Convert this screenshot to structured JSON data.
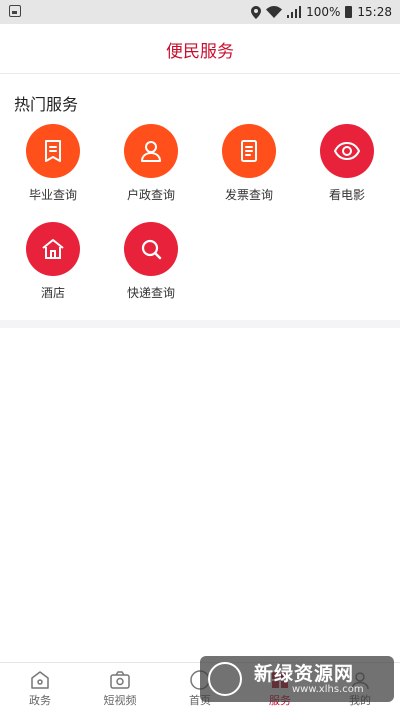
{
  "status_bar": {
    "battery": "100%",
    "time": "15:28"
  },
  "header": {
    "title": "便民服务"
  },
  "section": {
    "title": "热门服务"
  },
  "services": [
    {
      "label": "毕业查询",
      "icon": "bookmark-doc-icon",
      "color": "#ff4f1a"
    },
    {
      "label": "户政查询",
      "icon": "person-icon",
      "color": "#ff4f1a"
    },
    {
      "label": "发票查询",
      "icon": "document-icon",
      "color": "#ff4f1a"
    },
    {
      "label": "看电影",
      "icon": "eye-icon",
      "color": "#e8223a"
    },
    {
      "label": "酒店",
      "icon": "house-icon",
      "color": "#e8223a"
    },
    {
      "label": "快递查询",
      "icon": "search-icon",
      "color": "#e8223a"
    }
  ],
  "tabbar": {
    "active_color": "#c8102e",
    "items": [
      {
        "label": "政务",
        "icon": "building-icon"
      },
      {
        "label": "短视频",
        "icon": "camera-icon"
      },
      {
        "label": "首页",
        "icon": "home-icon"
      },
      {
        "label": "服务",
        "icon": "grid-icon"
      },
      {
        "label": "我的",
        "icon": "user-icon"
      }
    ]
  },
  "watermark": {
    "main": "新绿资源网",
    "sub": "www.xlhs.com"
  }
}
